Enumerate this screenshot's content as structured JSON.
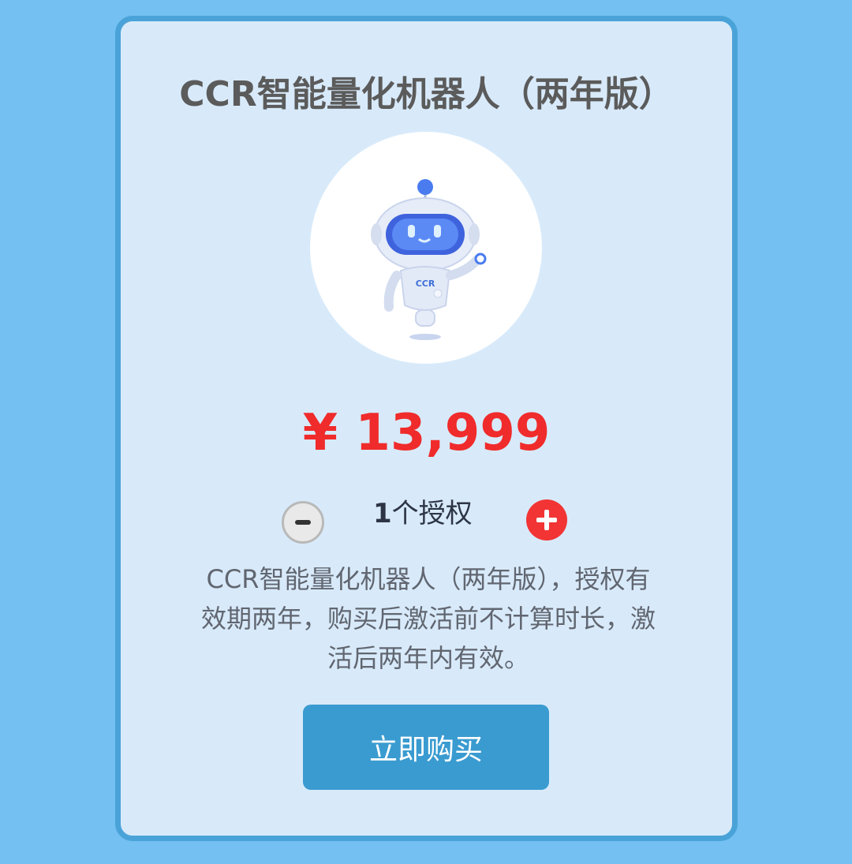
{
  "product": {
    "title": "CCR智能量化机器人（两年版）",
    "image_alt": "robot-mascot",
    "robot_badge": "CCR",
    "price": "¥ 13,999",
    "description": "CCR智能量化机器人（两年版），授权有效期两年，购买后激活前不计算时长，激活后两年内有效。"
  },
  "quantity": {
    "value": "1",
    "unit_label": "个授权"
  },
  "actions": {
    "buy_label": "立即购买"
  },
  "colors": {
    "background": "#74c0f2",
    "card": "#d8eafa",
    "card_border": "#4aa3d8",
    "price": "#f02b2b",
    "buy_button": "#3a9bd0",
    "plus_button": "#f23434"
  }
}
